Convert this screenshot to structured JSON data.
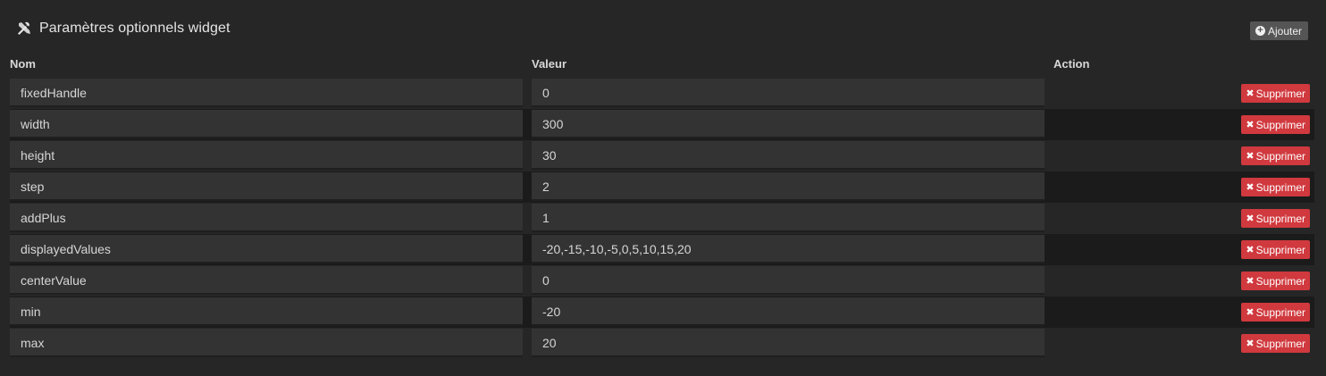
{
  "header": {
    "title": "Paramètres optionnels widget",
    "icon": "tools-icon",
    "add_label": "Ajouter",
    "add_icon": "plus-circle-icon"
  },
  "columns": {
    "name": "Nom",
    "value": "Valeur",
    "action": "Action"
  },
  "delete_label": "Supprimer",
  "colors": {
    "background": "#262626",
    "input_bg": "#333333",
    "delete_button": "#d0393e",
    "add_button": "#555555"
  },
  "rows": [
    {
      "name": "fixedHandle",
      "value": "0"
    },
    {
      "name": "width",
      "value": "300"
    },
    {
      "name": "height",
      "value": "30"
    },
    {
      "name": "step",
      "value": "2"
    },
    {
      "name": "addPlus",
      "value": "1"
    },
    {
      "name": "displayedValues",
      "value": "-20,-15,-10,-5,0,5,10,15,20"
    },
    {
      "name": "centerValue",
      "value": "0"
    },
    {
      "name": "min",
      "value": "-20"
    },
    {
      "name": "max",
      "value": "20"
    }
  ]
}
